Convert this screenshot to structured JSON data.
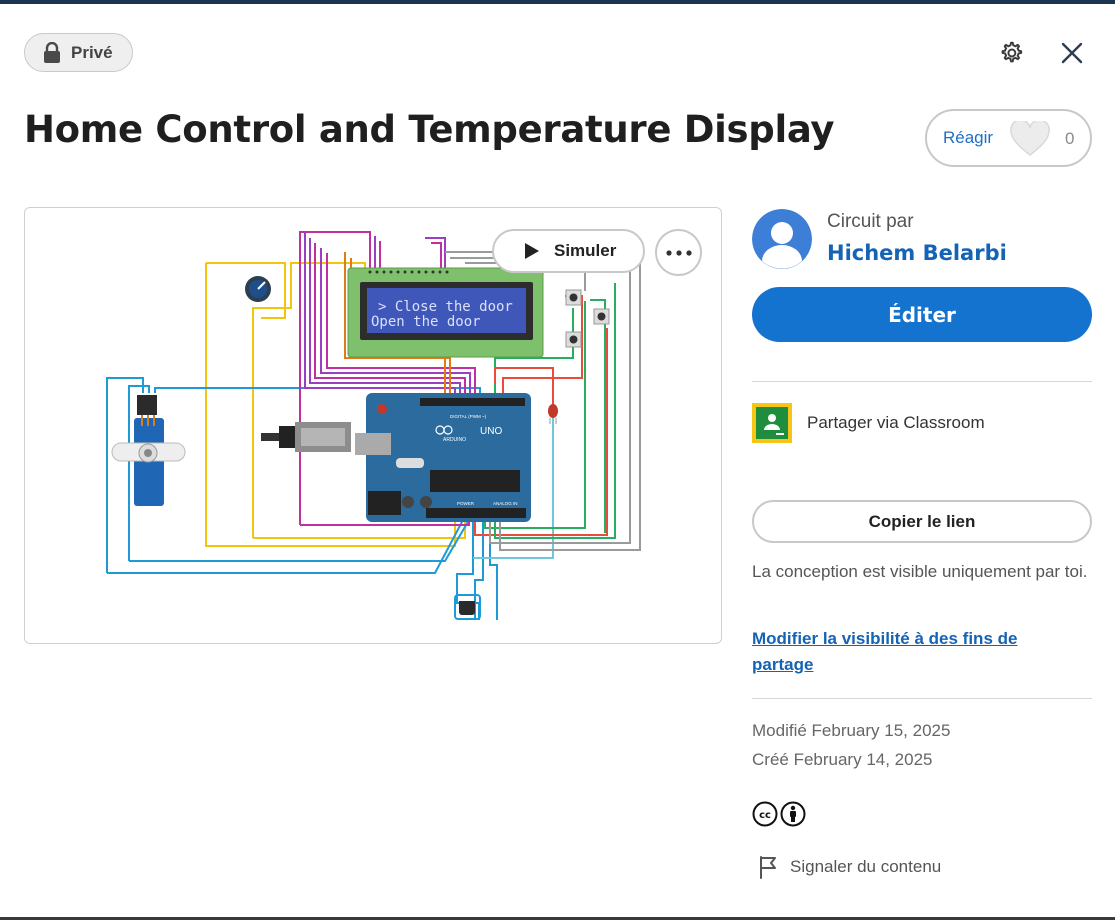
{
  "header": {
    "privacy_label": "Privé",
    "icons": {
      "lock": "lock-icon",
      "settings": "gear-icon",
      "close": "close-icon"
    }
  },
  "project": {
    "title": "Home Control and Temperature Display",
    "react_label": "Réagir",
    "react_count": "0"
  },
  "preview": {
    "simulate_label": "Simuler",
    "lcd_line1": "> Close the door",
    "lcd_line2": " Open the door",
    "board_label": "UNO",
    "board_brand": "ARDUINO",
    "digital_label": "DIGITAL (PWM ~)",
    "power_label": "POWER",
    "analog_label": "ANALOG IN"
  },
  "author": {
    "by_label": "Circuit par",
    "name": "Hichem Belarbi"
  },
  "actions": {
    "edit_label": "Éditer",
    "classroom_label": "Partager via Classroom",
    "copy_link_label": "Copier le lien"
  },
  "visibility": {
    "note": "La conception est visible uniquement par toi.",
    "link": "Modifier la visibilité à des fins de partage"
  },
  "dates": {
    "modified": "Modifié February 15, 2025",
    "created": "Créé February 14, 2025"
  },
  "license": {
    "icons": [
      "cc-icon",
      "by-attribution-icon"
    ]
  },
  "report": {
    "label": "Signaler du contenu"
  },
  "colors": {
    "accent": "#1473cf",
    "link": "#1563b5",
    "arduino": "#2b6b9e",
    "lcd_bezel": "#7ec06b"
  }
}
